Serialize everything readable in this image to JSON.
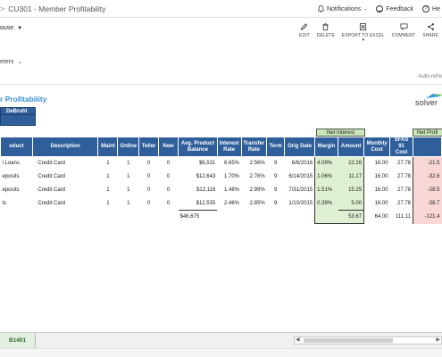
{
  "topbar": {
    "breadcrumb_sep": ">",
    "title": "CU301 - Member Profitability",
    "notifications_label": "Notifications",
    "feedback_label": "Feedback",
    "help_label": "He"
  },
  "toolbar": {
    "house_label": "ouse",
    "buttons": [
      {
        "label": "EDIT",
        "icon": "pencil-icon"
      },
      {
        "label": "DELETE",
        "icon": "trash-icon"
      },
      {
        "label": "EXPORT TO EXCEL",
        "icon": "excel-icon"
      },
      {
        "label": "COMMENT",
        "icon": "comment-icon"
      },
      {
        "label": "SHARE",
        "icon": "share-icon"
      }
    ],
    "parameters_label": "eters",
    "autorefresh_label": "Auto-refre"
  },
  "report": {
    "title": "r Profitability",
    "member_name": "DeBruhl",
    "logo_text": "solver",
    "group_headers": {
      "net_interest": "Net Interest",
      "net_profit": "Net Profi"
    },
    "columns": [
      "oduct",
      "Description",
      "Maint",
      "Online",
      "Teller",
      "New",
      "Avg. Product Balance",
      "Interest Rate",
      "Transfer Rate",
      "Term",
      "Orig Date",
      "Margin",
      "Amount",
      "Monthly Cost",
      "SFAS 91 Cost",
      ""
    ],
    "rows": [
      [
        "l Loans",
        "Credit Card",
        "1",
        "1",
        "0",
        "0",
        "$6,531",
        "6.65%",
        "2.56%",
        "9",
        "6/8/2016",
        "4.09%",
        "22.26",
        "16.00",
        "27.78",
        "-21.5"
      ],
      [
        "eposits",
        "Credit Card",
        "1",
        "1",
        "0",
        "0",
        "$12,643",
        "1.70%",
        "2.76%",
        "9",
        "6/14/2015",
        "1.06%",
        "11.17",
        "16.00",
        "27.78",
        "-32.6"
      ],
      [
        "eposits",
        "Credit Card",
        "1",
        "1",
        "0",
        "0",
        "$12,116",
        "1.48%",
        "2.99%",
        "9",
        "7/31/2015",
        "1.51%",
        "15.25",
        "16.00",
        "27.78",
        "-28.5"
      ],
      [
        "ts",
        "Credit Card",
        "1",
        "1",
        "0",
        "0",
        "$12,535",
        "2.46%",
        "2.85%",
        "9",
        "1/10/2015",
        "0.39%",
        "5.00",
        "16.00",
        "27.78",
        "-38.7"
      ]
    ],
    "totals": {
      "balance": "$46,675",
      "amount": "53.67",
      "monthly_cost": "64.00",
      "sfas_cost": "111.11",
      "net": "-121.4"
    }
  },
  "bottom": {
    "sheet_tab": "B1401"
  }
}
